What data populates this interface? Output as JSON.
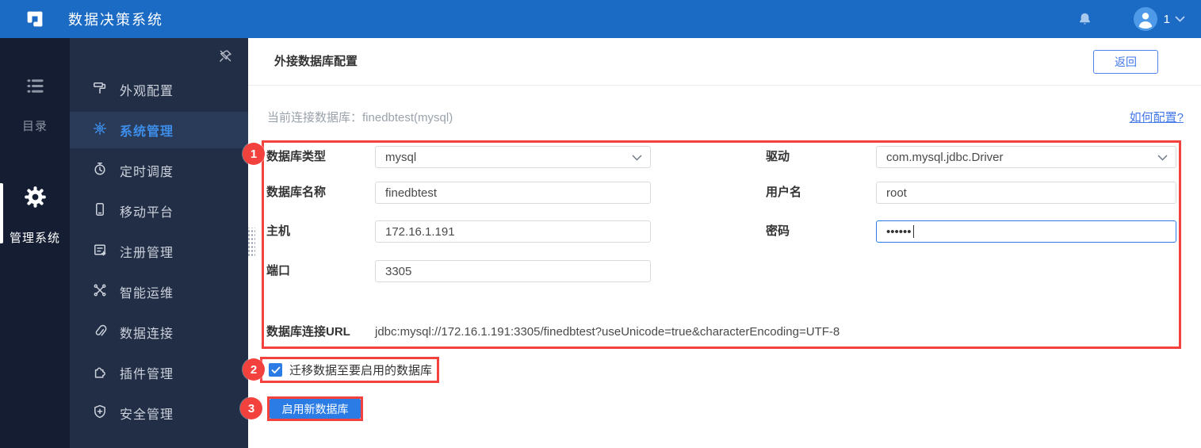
{
  "topbar": {
    "title": "数据决策系统",
    "username": "1",
    "icons": {
      "logo": "app-logo-icon",
      "bell": "notification-bell-icon",
      "avatar": "user-avatar-icon",
      "chevron": "chevron-down-icon"
    }
  },
  "rail": {
    "items": [
      {
        "label": "目录",
        "icon": "list-icon",
        "selected": false
      },
      {
        "label": "管理系统",
        "icon": "gear-icon",
        "selected": true
      }
    ]
  },
  "sidebar": {
    "unpin_icon": "unpin-icon",
    "items": [
      {
        "label": "外观配置",
        "icon": "paint-roller-icon",
        "selected": false
      },
      {
        "label": "系统管理",
        "icon": "gear-outline-icon",
        "selected": true
      },
      {
        "label": "定时调度",
        "icon": "stopwatch-icon",
        "selected": false
      },
      {
        "label": "移动平台",
        "icon": "mobile-icon",
        "selected": false
      },
      {
        "label": "注册管理",
        "icon": "register-doc-icon",
        "selected": false
      },
      {
        "label": "智能运维",
        "icon": "network-icon",
        "selected": false
      },
      {
        "label": "数据连接",
        "icon": "paperclip-icon",
        "selected": false
      },
      {
        "label": "插件管理",
        "icon": "puzzle-icon",
        "selected": false
      },
      {
        "label": "安全管理",
        "icon": "shield-plus-icon",
        "selected": false
      }
    ]
  },
  "main": {
    "title": "外接数据库配置",
    "back_button": "返回",
    "current_db_label": "当前连接数据库：",
    "current_db_value": "finedbtest(mysql)",
    "help_link": "如何配置?",
    "form": {
      "db_type": {
        "label": "数据库类型",
        "value": "mysql",
        "control": "select"
      },
      "driver": {
        "label": "驱动",
        "value": "com.mysql.jdbc.Driver",
        "control": "select"
      },
      "db_name": {
        "label": "数据库名称",
        "value": "finedbtest",
        "control": "input"
      },
      "username": {
        "label": "用户名",
        "value": "root",
        "control": "input"
      },
      "host": {
        "label": "主机",
        "value": "172.16.1.191",
        "control": "input"
      },
      "password": {
        "label": "密码",
        "value": "••••••",
        "masked": true,
        "focused": true
      },
      "port": {
        "label": "端口",
        "value": "3305",
        "control": "input"
      },
      "url": {
        "label": "数据库连接URL",
        "value": "jdbc:mysql://172.16.1.191:3305/finedbtest?useUnicode=true&characterEncoding=UTF-8"
      }
    },
    "migrate": {
      "label": "迁移数据至要启用的数据库",
      "checked": true
    },
    "enable_button": "启用新数据库",
    "annotations": {
      "step1": "1",
      "step2": "2",
      "step3": "3"
    }
  },
  "colors": {
    "topbar_blue": "#1b6bc4",
    "annotation_red": "#f3413e",
    "primary_blue": "#2b7ce5",
    "link_blue": "#4378e8",
    "selected_nav_blue": "#3d8dea",
    "rail_bg": "#141d31",
    "sidebar_bg": "#222e46"
  }
}
